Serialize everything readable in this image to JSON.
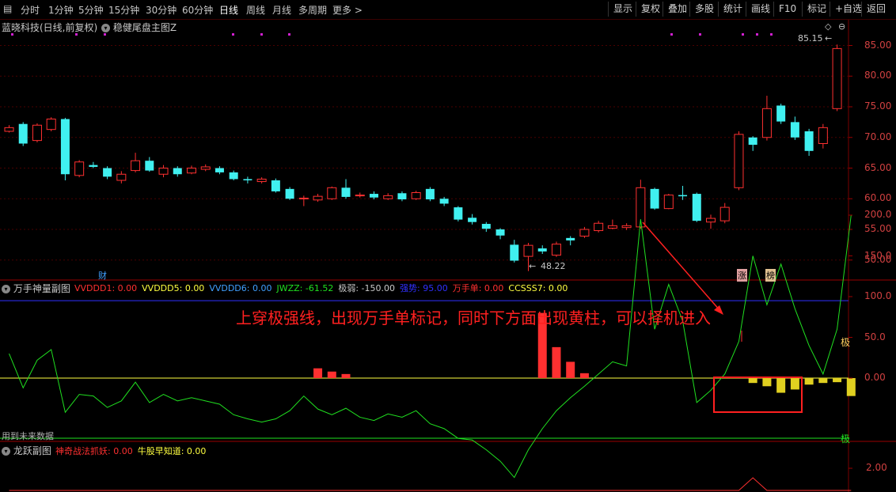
{
  "toolbar": {
    "periods": [
      "分时",
      "1分钟",
      "5分钟",
      "15分钟",
      "30分钟",
      "60分钟",
      "日线",
      "周线",
      "月线",
      "多周期",
      "更多 >"
    ],
    "active_period": "日线",
    "actions": [
      "显示",
      "复权",
      "叠加",
      "多股",
      "统计",
      "画线",
      "F10",
      "标记",
      "+自选",
      "返回"
    ]
  },
  "main_panel": {
    "stock_title": "蓝晓科技(日线,前复权)",
    "indicator_title": "稳健尾盘主图Z",
    "high_label": "85.15",
    "low_label": "48.22",
    "markers": [
      "财",
      "涨",
      "榜"
    ],
    "price_axis": [
      "85.00",
      "80.00",
      "75.00",
      "70.00",
      "65.00",
      "60.00",
      "55.00",
      "50.00"
    ]
  },
  "sub1": {
    "title": "万手神量副图",
    "legend": [
      {
        "label": "VVDDD1: 0.00",
        "color": "#ff3030"
      },
      {
        "label": "VVDDD5: 0.00",
        "color": "#ffff40"
      },
      {
        "label": "VVDDD6: 0.00",
        "color": "#40a0ff"
      },
      {
        "label": "JWZZ: -61.52",
        "color": "#20e020"
      },
      {
        "label": "极弱: -150.00",
        "color": "#c8c8c8"
      },
      {
        "label": "强势: 95.00",
        "color": "#3030ff"
      },
      {
        "label": "万手单: 0.00",
        "color": "#ff3030"
      },
      {
        "label": "CCSSS7: 0.00",
        "color": "#ffff40"
      }
    ],
    "axis": [
      "200.0",
      "150.0",
      "100.0",
      "50.0",
      "0.00"
    ],
    "strong_tag": "极",
    "weak_tag": "极",
    "future_note": "用到未来数据",
    "annotation": "上穿极强线，出现万手单标记，同时下方面出现黄柱，可以择机进入"
  },
  "sub2": {
    "title": "龙跃副图",
    "legend": [
      {
        "label": "神奇战法抓妖: 0.00",
        "color": "#ff3030"
      },
      {
        "label": "牛股早知道: 0.00",
        "color": "#ffff40"
      }
    ],
    "axis": [
      "2.00"
    ]
  },
  "colors": {
    "up": "#ff3030",
    "down": "#40f0f0",
    "strong_line": "#3030ff",
    "zero_line": "#ffff40",
    "jwzz": "#20e020",
    "annotation": "#ff2020"
  },
  "chart_data": {
    "type": "candlestick",
    "ylim": [
      47,
      87
    ],
    "candles": [
      {
        "o": 71.0,
        "c": 71.6,
        "h": 72.0,
        "l": 70.8
      },
      {
        "o": 72.2,
        "c": 69.0,
        "h": 72.5,
        "l": 68.6
      },
      {
        "o": 69.5,
        "c": 72.0,
        "h": 72.3,
        "l": 69.2
      },
      {
        "o": 71.3,
        "c": 73.0,
        "h": 73.3,
        "l": 71.0
      },
      {
        "o": 73.0,
        "c": 64.0,
        "h": 73.2,
        "l": 63.0
      },
      {
        "o": 63.8,
        "c": 66.0,
        "h": 66.3,
        "l": 63.5
      },
      {
        "o": 65.5,
        "c": 65.2,
        "h": 66.0,
        "l": 65.0
      },
      {
        "o": 65.0,
        "c": 63.6,
        "h": 65.3,
        "l": 63.2
      },
      {
        "o": 63.0,
        "c": 64.0,
        "h": 64.5,
        "l": 62.5
      },
      {
        "o": 64.6,
        "c": 66.2,
        "h": 67.5,
        "l": 64.3
      },
      {
        "o": 66.2,
        "c": 64.6,
        "h": 66.8,
        "l": 64.4
      },
      {
        "o": 64.0,
        "c": 65.0,
        "h": 65.5,
        "l": 63.5
      },
      {
        "o": 65.0,
        "c": 64.0,
        "h": 65.3,
        "l": 63.6
      },
      {
        "o": 64.2,
        "c": 65.0,
        "h": 65.4,
        "l": 64.0
      },
      {
        "o": 64.8,
        "c": 65.2,
        "h": 65.6,
        "l": 64.5
      },
      {
        "o": 65.0,
        "c": 64.3,
        "h": 65.3,
        "l": 64.0
      },
      {
        "o": 64.3,
        "c": 63.2,
        "h": 64.6,
        "l": 63.0
      },
      {
        "o": 63.2,
        "c": 63.0,
        "h": 63.6,
        "l": 62.5
      },
      {
        "o": 62.8,
        "c": 63.2,
        "h": 63.5,
        "l": 62.5
      },
      {
        "o": 63.0,
        "c": 61.2,
        "h": 63.3,
        "l": 61.0
      },
      {
        "o": 61.6,
        "c": 60.0,
        "h": 61.9,
        "l": 59.8
      },
      {
        "o": 60.0,
        "c": 60.1,
        "h": 60.5,
        "l": 58.8
      },
      {
        "o": 59.8,
        "c": 60.4,
        "h": 60.8,
        "l": 59.5
      },
      {
        "o": 60.0,
        "c": 61.8,
        "h": 62.0,
        "l": 59.8
      },
      {
        "o": 61.8,
        "c": 60.3,
        "h": 63.2,
        "l": 60.0
      },
      {
        "o": 60.5,
        "c": 60.6,
        "h": 61.0,
        "l": 60.2
      },
      {
        "o": 60.8,
        "c": 60.2,
        "h": 61.2,
        "l": 59.9
      },
      {
        "o": 60.0,
        "c": 60.5,
        "h": 60.9,
        "l": 59.8
      },
      {
        "o": 60.9,
        "c": 59.9,
        "h": 61.2,
        "l": 59.6
      },
      {
        "o": 60.0,
        "c": 61.0,
        "h": 61.3,
        "l": 59.8
      },
      {
        "o": 61.6,
        "c": 59.9,
        "h": 61.9,
        "l": 59.6
      },
      {
        "o": 60.0,
        "c": 59.2,
        "h": 60.3,
        "l": 58.8
      },
      {
        "o": 58.6,
        "c": 56.6,
        "h": 58.8,
        "l": 56.3
      },
      {
        "o": 56.9,
        "c": 56.2,
        "h": 57.5,
        "l": 55.8
      },
      {
        "o": 55.9,
        "c": 55.1,
        "h": 56.2,
        "l": 54.6
      },
      {
        "o": 55.0,
        "c": 54.0,
        "h": 55.2,
        "l": 53.4
      },
      {
        "o": 52.5,
        "c": 49.9,
        "h": 53.3,
        "l": 49.6
      },
      {
        "o": 50.6,
        "c": 52.4,
        "h": 52.8,
        "l": 48.2
      },
      {
        "o": 51.9,
        "c": 51.4,
        "h": 52.4,
        "l": 51.0
      },
      {
        "o": 50.8,
        "c": 52.6,
        "h": 53.0,
        "l": 50.5
      },
      {
        "o": 53.6,
        "c": 53.2,
        "h": 53.9,
        "l": 52.4
      },
      {
        "o": 53.9,
        "c": 55.0,
        "h": 55.4,
        "l": 53.6
      },
      {
        "o": 54.8,
        "c": 56.0,
        "h": 56.4,
        "l": 54.5
      },
      {
        "o": 55.2,
        "c": 55.6,
        "h": 56.6,
        "l": 55.0
      },
      {
        "o": 55.3,
        "c": 55.6,
        "h": 56.0,
        "l": 54.9
      },
      {
        "o": 55.4,
        "c": 61.8,
        "h": 63.1,
        "l": 55.1
      },
      {
        "o": 61.6,
        "c": 58.4,
        "h": 61.8,
        "l": 58.2
      },
      {
        "o": 58.4,
        "c": 60.6,
        "h": 60.8,
        "l": 58.3
      },
      {
        "o": 60.6,
        "c": 60.4,
        "h": 62.1,
        "l": 59.8
      },
      {
        "o": 60.8,
        "c": 56.4,
        "h": 61.0,
        "l": 56.2
      },
      {
        "o": 56.2,
        "c": 56.8,
        "h": 57.4,
        "l": 55.1
      },
      {
        "o": 56.4,
        "c": 58.6,
        "h": 59.3,
        "l": 56.0
      },
      {
        "o": 61.8,
        "c": 70.5,
        "h": 71.0,
        "l": 61.4
      },
      {
        "o": 70.0,
        "c": 68.8,
        "h": 70.2,
        "l": 67.8
      },
      {
        "o": 70.0,
        "c": 74.7,
        "h": 76.8,
        "l": 69.5
      },
      {
        "o": 75.2,
        "c": 72.6,
        "h": 75.5,
        "l": 72.2
      },
      {
        "o": 72.5,
        "c": 70.0,
        "h": 73.4,
        "l": 69.6
      },
      {
        "o": 71.0,
        "c": 67.8,
        "h": 71.4,
        "l": 67.0
      },
      {
        "o": 69.0,
        "c": 71.6,
        "h": 72.2,
        "l": 68.2
      },
      {
        "o": 74.7,
        "c": 84.5,
        "h": 85.15,
        "l": 74.3
      }
    ],
    "jwzz": [
      30,
      -12,
      22,
      35,
      -42,
      -20,
      -22,
      -36,
      -28,
      -5,
      -30,
      -20,
      -28,
      -24,
      -28,
      -32,
      -45,
      -50,
      -54,
      -50,
      -40,
      -22,
      -38,
      -45,
      -37,
      -48,
      -52,
      -44,
      -48,
      -40,
      -56,
      -62,
      -74,
      -76,
      -88,
      -102,
      -122,
      -88,
      -62,
      -40,
      -24,
      -10,
      5,
      20,
      15,
      195,
      60,
      115,
      70,
      -30,
      -15,
      5,
      45,
      150,
      90,
      140,
      85,
      40,
      5,
      60,
      200
    ],
    "wanshou_bars": [
      {
        "i": 22,
        "v": 12
      },
      {
        "i": 23,
        "v": 8
      },
      {
        "i": 24,
        "v": 5
      },
      {
        "i": 38,
        "v": 80
      },
      {
        "i": 39,
        "v": 38
      },
      {
        "i": 40,
        "v": 20
      },
      {
        "i": 41,
        "v": 6
      }
    ],
    "yellow_bars": [
      {
        "i": 53,
        "v": -6
      },
      {
        "i": 54,
        "v": -10
      },
      {
        "i": 55,
        "v": -18
      },
      {
        "i": 56,
        "v": -14
      },
      {
        "i": 57,
        "v": -8
      },
      {
        "i": 58,
        "v": -6
      },
      {
        "i": 59,
        "v": -5
      },
      {
        "i": 60,
        "v": -22
      }
    ],
    "longyue": [
      0,
      0,
      0,
      0,
      0,
      0,
      0,
      0,
      0,
      0,
      0,
      0,
      0,
      0,
      0,
      0,
      0,
      0,
      0,
      0,
      0,
      0,
      0,
      0,
      0,
      0,
      0,
      0,
      0,
      0,
      0,
      0,
      0,
      0,
      0,
      0,
      0,
      0,
      0,
      0,
      0,
      0,
      0,
      0,
      0,
      0,
      0,
      0,
      0,
      0,
      0,
      0,
      0,
      1,
      0,
      0,
      0,
      0,
      0,
      0,
      0
    ]
  }
}
